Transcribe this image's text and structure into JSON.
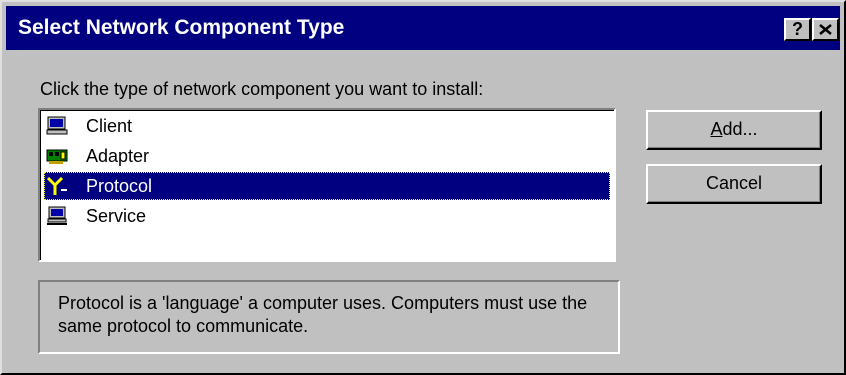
{
  "window": {
    "title": "Select Network Component Type",
    "help_label": "?"
  },
  "prompt": "Click the type of network component you want to install:",
  "components": [
    {
      "label": "Client",
      "icon": "client-computer-icon",
      "selected": false
    },
    {
      "label": "Adapter",
      "icon": "network-adapter-icon",
      "selected": false
    },
    {
      "label": "Protocol",
      "icon": "protocol-plug-icon",
      "selected": true
    },
    {
      "label": "Service",
      "icon": "service-computer-icon",
      "selected": false
    }
  ],
  "description": "Protocol is a 'language' a computer uses. Computers must use the same protocol to communicate.",
  "buttons": {
    "add_accel": "A",
    "add_rest": "dd...",
    "cancel": "Cancel"
  },
  "colors": {
    "title_bar": "#000080",
    "face": "#c0c0c0",
    "selection": "#000080"
  }
}
